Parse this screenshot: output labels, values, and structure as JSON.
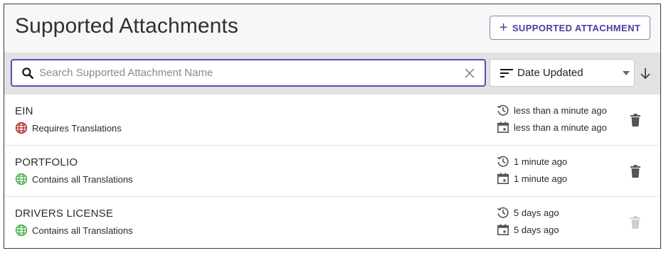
{
  "header": {
    "title": "Supported Attachments",
    "add_button_icon": "+",
    "add_button_label": "SUPPORTED ATTACHMENT"
  },
  "toolbar": {
    "search_placeholder": "Search Supported Attachment Name",
    "search_value": "",
    "sort_label": "Date Updated",
    "sort_direction": "descending"
  },
  "colors": {
    "accent": "#4a3f9f",
    "requires_translations": "#b42a2a",
    "all_translations": "#4caf50",
    "icon_grey": "#555555",
    "trash_disabled": "#cfcfcf"
  },
  "items": [
    {
      "name": "EIN",
      "translation_status": "Requires Translations",
      "translation_icon": "globe-red-icon",
      "updated": "less than a minute ago",
      "created": "less than a minute ago",
      "delete_enabled": true
    },
    {
      "name": "PORTFOLIO",
      "translation_status": "Contains all Translations",
      "translation_icon": "globe-green-icon",
      "updated": "1 minute ago",
      "created": "1 minute ago",
      "delete_enabled": true
    },
    {
      "name": "DRIVERS LICENSE",
      "translation_status": "Contains all Translations",
      "translation_icon": "globe-green-icon",
      "updated": "5 days ago",
      "created": "5 days ago",
      "delete_enabled": false
    }
  ]
}
